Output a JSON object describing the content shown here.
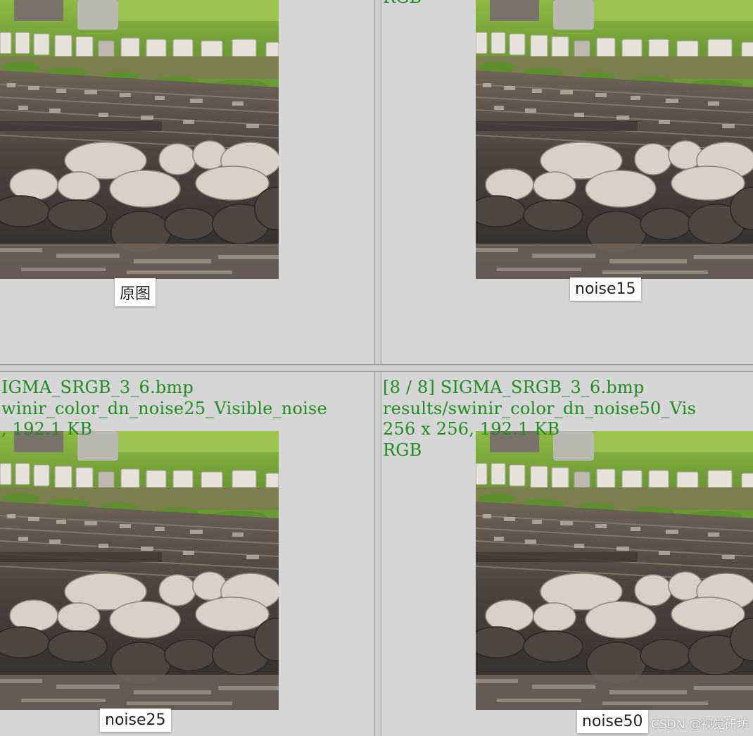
{
  "panes": {
    "top_left": {
      "caption": "原图"
    },
    "top_right": {
      "info_fragment": "RGB",
      "caption": "noise15"
    },
    "bottom_left": {
      "info_lines": [
        "IGMA_SRGB_3_6.bmp",
        "winir_color_dn_noise25_Visible_noise",
        ", 192.1 KB"
      ],
      "caption": "noise25"
    },
    "bottom_right": {
      "info_lines": [
        "[8 / 8] SIGMA_SRGB_3_6.bmp",
        "results/swinir_color_dn_noise50_Vis",
        "256 x 256, 192.1 KB",
        "RGB"
      ],
      "caption": "noise50"
    }
  },
  "watermark": "CSDN @视觉研坊",
  "colors": {
    "background": "#d6d6d6",
    "info_text": "#1e8c1e",
    "caption_bg": "#ffffff"
  }
}
